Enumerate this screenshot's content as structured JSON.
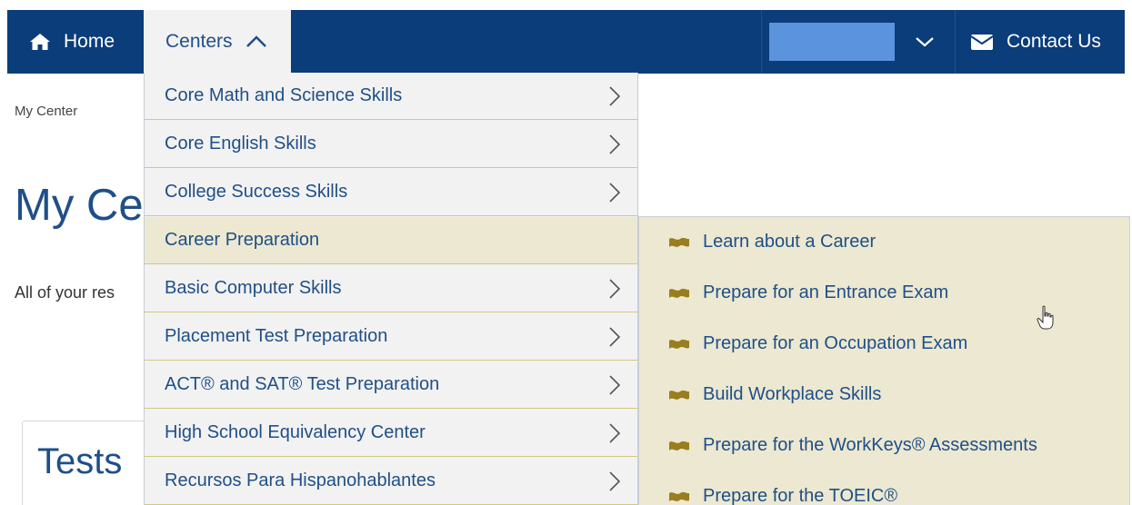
{
  "nav": {
    "home_label": "Home",
    "centers_label": "Centers",
    "contact_label": "Contact Us",
    "home_icon": "home-icon",
    "centers_icon": "chevron-up-icon",
    "user_dropdown_icon": "chevron-down-icon",
    "contact_icon": "envelope-icon",
    "background_color": "#0a3d7a"
  },
  "page": {
    "breadcrumb": "My Center",
    "title": "My Ce",
    "intro": "All of your res",
    "tests_title": "Tests"
  },
  "menu": {
    "items": [
      {
        "label": "Core Math and Science Skills",
        "has_arrow": true
      },
      {
        "label": "Core English Skills",
        "has_arrow": true
      },
      {
        "label": "College Success Skills",
        "has_arrow": true
      },
      {
        "label": "Career Preparation",
        "has_arrow": false,
        "active": true
      },
      {
        "label": "Basic Computer Skills",
        "has_arrow": true
      },
      {
        "label": "Placement Test Preparation",
        "has_arrow": true
      },
      {
        "label": "ACT® and SAT® Test Preparation",
        "has_arrow": true
      },
      {
        "label": "High School Equivalency Center",
        "has_arrow": true
      },
      {
        "label": "Recursos Para Hispanohablantes",
        "has_arrow": true
      }
    ]
  },
  "submenu": {
    "icon": "flag-icon",
    "icon_color": "#9a7d1e",
    "items": [
      {
        "label": "Learn about a Career"
      },
      {
        "label": "Prepare for an Entrance Exam"
      },
      {
        "label": "Prepare for an Occupation Exam"
      },
      {
        "label": "Build Workplace Skills"
      },
      {
        "label": "Prepare for the WorkKeys® Assessments"
      },
      {
        "label": "Prepare for the TOEIC®"
      }
    ]
  }
}
